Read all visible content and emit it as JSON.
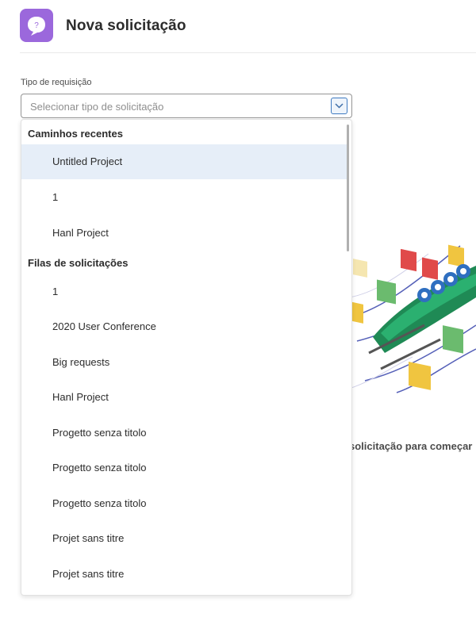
{
  "header": {
    "title": "Nova solicitação",
    "icon": "help-chat-icon"
  },
  "form": {
    "label": "Tipo de requisição",
    "placeholder": "Selecionar tipo de solicitação"
  },
  "dropdown": {
    "recent_header": "Caminhos recentes",
    "recent_items": [
      "Untitled Project",
      "1",
      "Hanl Project"
    ],
    "queues_header": "Filas de solicitações",
    "queue_items": [
      "1",
      "2020 User Conference",
      "Big requests",
      "Hanl Project",
      "Progetto senza titolo",
      "Progetto senza titolo",
      "Progetto senza titolo",
      "Projet sans titre",
      "Projet sans titre"
    ]
  },
  "empty_state": {
    "hint": "solicitação para começar"
  },
  "colors": {
    "accent": "#9b68dc",
    "highlight": "#e6eef8",
    "select_border": "#959595",
    "toggle_border": "#3e7ac0"
  }
}
